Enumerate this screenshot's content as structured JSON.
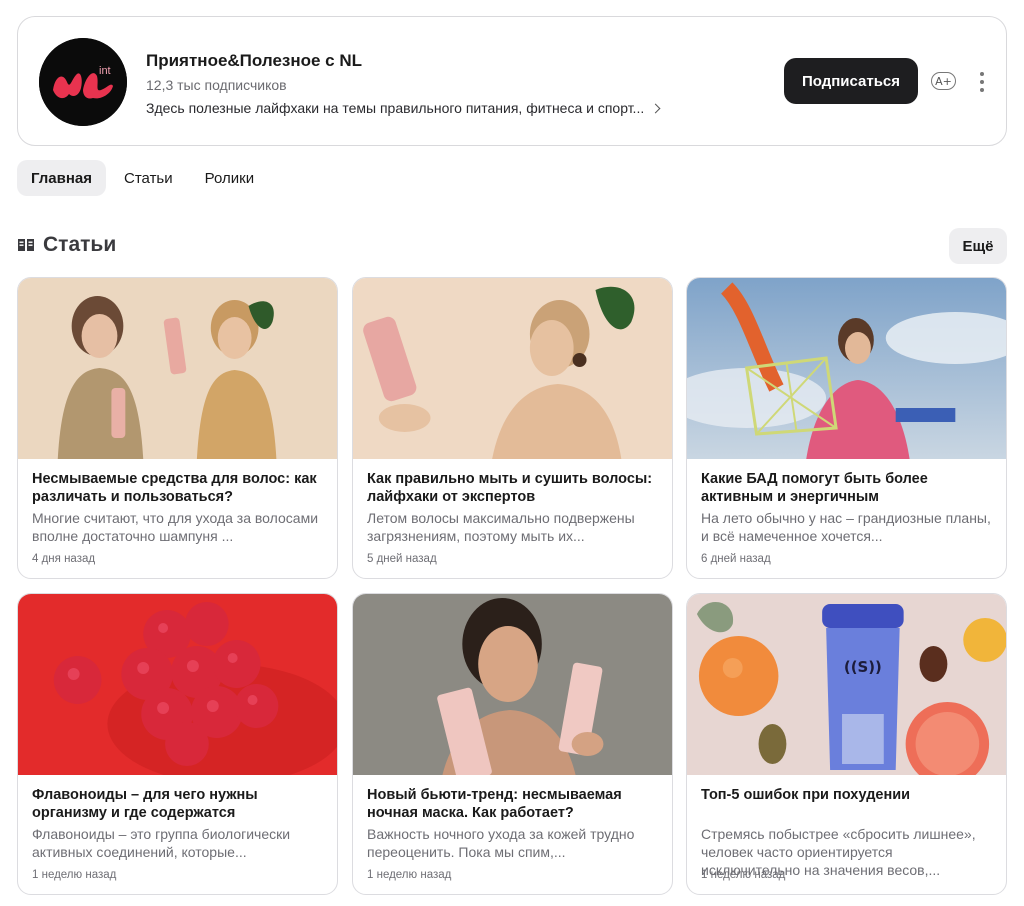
{
  "channel": {
    "title": "Приятное&Полезное с NL",
    "subscribers": "12,3 тыс подписчиков",
    "description": "Здесь полезные лайфхаки на темы правильного питания, фитнеса и спорт...",
    "subscribe_label": "Подписаться",
    "font_size_label": "A+",
    "avatar_logo_text": "int"
  },
  "tabs": [
    {
      "label": "Главная",
      "active": true
    },
    {
      "label": "Статьи",
      "active": false
    },
    {
      "label": "Ролики",
      "active": false
    }
  ],
  "section": {
    "title": "Статьи",
    "more_label": "Ещё"
  },
  "articles": [
    {
      "title": "Несмываемые средства для волос: как различать и пользоваться?",
      "excerpt": "Многие считают, что для ухода за волосами вполне достаточно шампуня ...",
      "date": "4 дня назад",
      "image": "two-women-holding-hair-products"
    },
    {
      "title": "Как правильно мыть и сушить волосы: лайфхаки от экспертов",
      "excerpt": "Летом волосы максимально подвержены загрязнениям, поэтому мыть их...",
      "date": "5 дней назад",
      "image": "woman-with-hair-tube"
    },
    {
      "title": "Какие БАД помогут быть более активным и энергичным",
      "excerpt": "На лето обычно у нас – грандиозные планы, и всё намеченное хочется...",
      "date": "6 дней назад",
      "image": "woman-with-mesh-bag-sky"
    },
    {
      "title": "Флавоноиды – для чего нужны организму и где содержатся",
      "excerpt": "Флавоноиды – это группа биологически активных соединений, которые...",
      "date": "1 неделю назад",
      "image": "raspberries-red-background"
    },
    {
      "title": "Новый бьюти-тренд: несмываемая ночная маска. Как работает?",
      "excerpt": "Важность ночного ухода за кожей трудно переоценить. Пока мы спим,...",
      "date": "1 неделю назад",
      "image": "woman-with-cosmetic-tubes"
    },
    {
      "title": "Топ-5 ошибок при похудении",
      "excerpt": "Стремясь побыстрее «сбросить лишнее», человек часто ориентируется исключительно на значения весов,...",
      "date": "1 неделю назад",
      "image": "shaker-bottle-with-fruits",
      "bottle_label": "((S))"
    }
  ],
  "colors": {
    "accent_dark": "#1e1e20",
    "tab_active_bg": "#eeeef0",
    "logo_pink": "#e8334f"
  }
}
